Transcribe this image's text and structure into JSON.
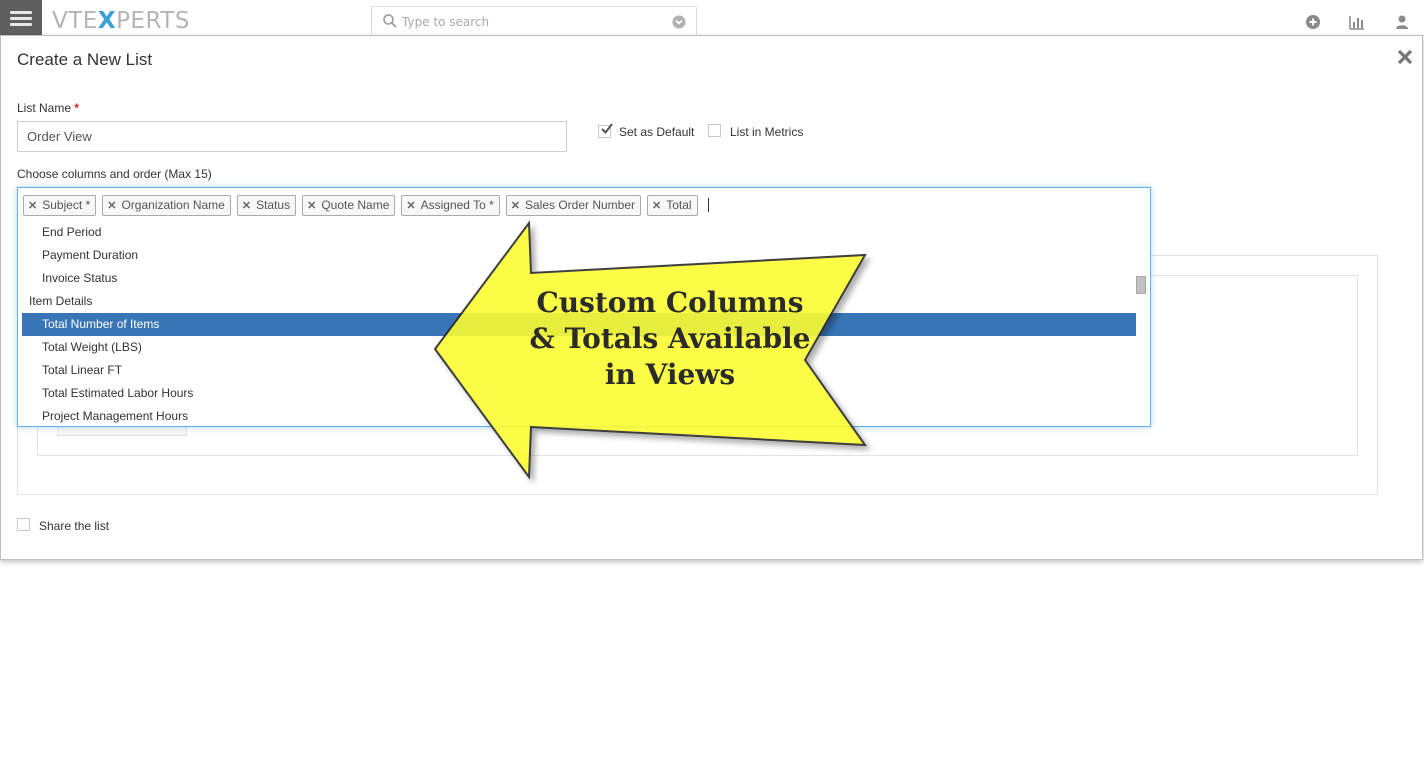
{
  "topbar": {
    "brand_prefix": "VTE",
    "brand_x": "X",
    "brand_suffix": "PERTS",
    "search_placeholder": "Type to search",
    "icons": [
      "menu-icon",
      "search-icon",
      "chevron-down-icon",
      "plus-circle-icon",
      "bar-chart-icon",
      "user-icon"
    ]
  },
  "modal": {
    "title": "Create a New List",
    "list_name_label": "List Name",
    "required_mark": "*",
    "list_name_value": "Order View",
    "set_as_default_label": "Set as Default",
    "set_as_default_checked": true,
    "list_in_metrics_label": "List in Metrics",
    "list_in_metrics_checked": false,
    "columns_label": "Choose columns and order (Max 15)",
    "selected_columns": [
      "Subject *",
      "Organization Name",
      "Status",
      "Quote Name",
      "Assigned To *",
      "Sales Order Number",
      "Total"
    ],
    "options": [
      {
        "label": "End Period",
        "type": "item"
      },
      {
        "label": "Payment Duration",
        "type": "item"
      },
      {
        "label": "Invoice Status",
        "type": "item"
      },
      {
        "label": "Item Details",
        "type": "group"
      },
      {
        "label": "Total Number of Items",
        "type": "item",
        "highlighted": true
      },
      {
        "label": "Total Weight (LBS)",
        "type": "item"
      },
      {
        "label": "Total Linear FT",
        "type": "item"
      },
      {
        "label": "Total Estimated Labor Hours",
        "type": "item"
      },
      {
        "label": "Project Management Hours",
        "type": "item"
      }
    ],
    "share_label": "Share the list",
    "share_checked": false
  },
  "annotation": {
    "line1": "Custom Columns",
    "line2": "& Totals Available",
    "line3": "in Views",
    "fill_color": "#fbfc33",
    "stroke_color": "#2b2b2b"
  },
  "colors": {
    "highlight": "#3875b7",
    "focus_border": "#66afe9",
    "menu_bg": "#5f5f5f",
    "brand_accent": "#3aa0d8"
  }
}
